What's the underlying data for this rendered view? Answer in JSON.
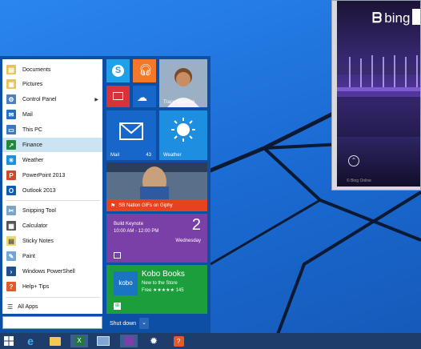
{
  "browser": {
    "bing_label": "bing",
    "footer": "© Bing Online"
  },
  "start_menu": {
    "apps": [
      {
        "label": "Documents",
        "icon": "documents-folder-icon",
        "color": "#e8c25a"
      },
      {
        "label": "Pictures",
        "icon": "pictures-folder-icon",
        "color": "#e8c25a"
      },
      {
        "label": "Control Panel",
        "icon": "control-panel-icon",
        "color": "#4a7fc0",
        "has_arrow": true
      },
      {
        "label": "Mail",
        "icon": "mail-icon",
        "color": "#1b6ed6"
      },
      {
        "label": "This PC",
        "icon": "computer-icon",
        "color": "#3b78c4"
      },
      {
        "label": "Finance",
        "icon": "finance-icon",
        "color": "#1f8a3a",
        "selected": true
      },
      {
        "label": "Weather",
        "icon": "weather-icon",
        "color": "#1e8fe0"
      },
      {
        "label": "PowerPoint 2013",
        "icon": "powerpoint-icon",
        "color": "#d24726"
      },
      {
        "label": "Outlook 2013",
        "icon": "outlook-icon",
        "color": "#0f5cb4"
      },
      {
        "label": "Snipping Tool",
        "icon": "scissors-icon",
        "color": "#7aa5c9"
      },
      {
        "label": "Calculator",
        "icon": "calculator-icon",
        "color": "#555555"
      },
      {
        "label": "Sticky Notes",
        "icon": "sticky-notes-icon",
        "color": "#e9d96a"
      },
      {
        "label": "Paint",
        "icon": "paint-icon",
        "color": "#6ea7d8"
      },
      {
        "label": "Windows PowerShell",
        "icon": "powershell-icon",
        "color": "#1d4f91"
      },
      {
        "label": "Help+ Tips",
        "icon": "help-tips-icon",
        "color": "#e25b2a"
      }
    ],
    "all_apps_label": "All Apps",
    "shutdown_label": "Shut down",
    "tiles": {
      "skype": {
        "icon": "skype-icon",
        "color": "#1ea1e8"
      },
      "music": {
        "icon": "headphones-icon",
        "color": "#f4782a"
      },
      "person": {
        "name": "Tracy Myerson"
      },
      "video": {
        "icon": "video-icon",
        "color": "#d9323a"
      },
      "onedrive": {
        "icon": "cloud-icon",
        "color": "#1766c9"
      },
      "mail": {
        "label": "Mail",
        "count": "43",
        "color": "#1766c9"
      },
      "weather": {
        "label": "Weather",
        "color": "#1e8fe0"
      },
      "news": {
        "caption": "SB Nation GIFs on Giphy",
        "color": "#e8411f"
      },
      "calendar": {
        "event": "Build Keynote",
        "time": "10:00 AM - 12:00 PM",
        "day_number": "2",
        "day_name": "Wednesday",
        "color": "#7b3fa8"
      },
      "store": {
        "title": "Kobo Books",
        "subtitle": "New to the Store",
        "rating": "Free ★★★★★ 145",
        "logo": "kobo",
        "color": "#1c9e3c"
      }
    }
  },
  "taskbar": {
    "items": [
      {
        "icon": "windows-start-icon"
      },
      {
        "icon": "internet-explorer-icon"
      },
      {
        "icon": "file-explorer-icon"
      },
      {
        "icon": "excel-icon"
      },
      {
        "icon": "explorer-window-icon"
      },
      {
        "icon": "media-icon"
      },
      {
        "icon": "settings-icon"
      },
      {
        "icon": "help-icon"
      }
    ]
  }
}
